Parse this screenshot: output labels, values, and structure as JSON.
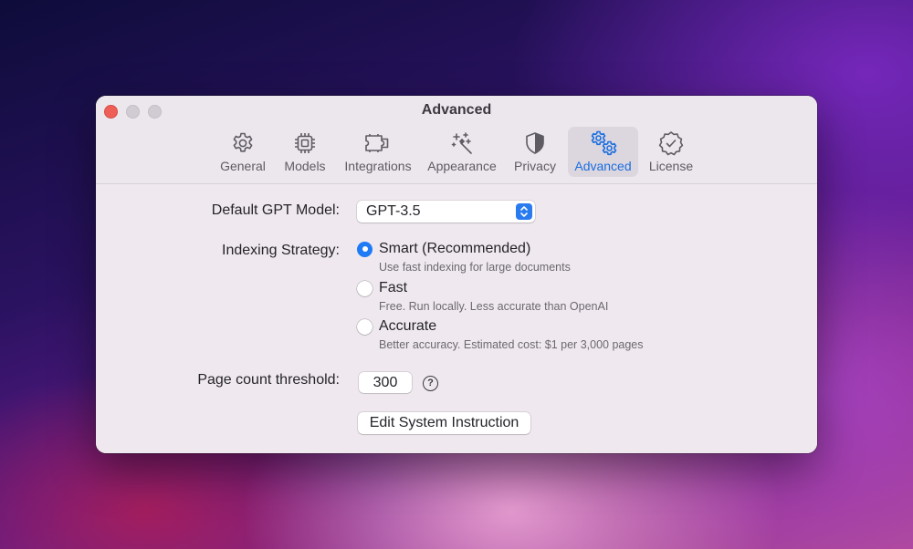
{
  "window": {
    "title": "Advanced"
  },
  "tabs": [
    {
      "label": "General",
      "icon": "gear-icon"
    },
    {
      "label": "Models",
      "icon": "chip-icon"
    },
    {
      "label": "Integrations",
      "icon": "plugin-icon"
    },
    {
      "label": "Appearance",
      "icon": "magic-wand-icon"
    },
    {
      "label": "Privacy",
      "icon": "shield-icon"
    },
    {
      "label": "Advanced",
      "icon": "gears-icon",
      "selected": true
    },
    {
      "label": "License",
      "icon": "seal-check-icon"
    }
  ],
  "settings": {
    "model_label": "Default GPT Model:",
    "model_value": "GPT-3.5",
    "indexing_label": "Indexing Strategy:",
    "options": [
      {
        "title": "Smart (Recommended)",
        "desc": "Use fast indexing for large documents",
        "selected": true
      },
      {
        "title": "Fast",
        "desc": "Free. Run locally. Less accurate than OpenAI",
        "selected": false
      },
      {
        "title": "Accurate",
        "desc": "Better accuracy. Estimated cost: $1 per 3,000 pages",
        "selected": false
      }
    ],
    "threshold_label": "Page count threshold:",
    "threshold_value": "300",
    "help_glyph": "?",
    "edit_button": "Edit System Instruction"
  },
  "colors": {
    "accent": "#1f7af5",
    "close": "#ee5e57"
  }
}
